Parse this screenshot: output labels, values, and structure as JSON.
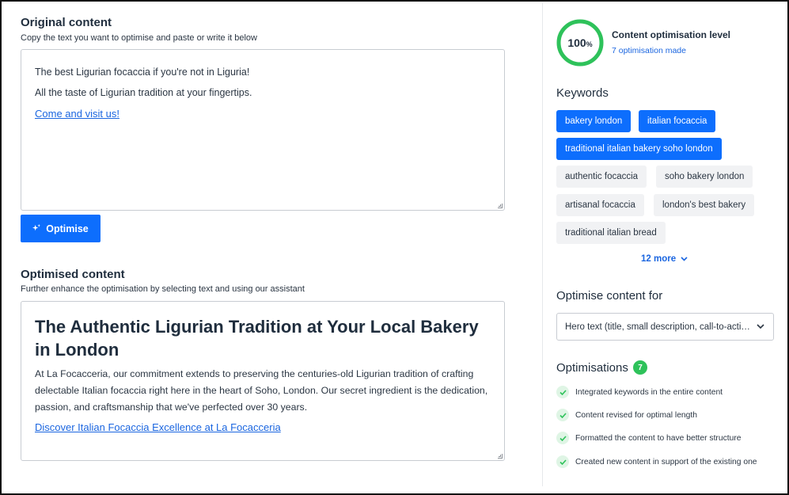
{
  "original": {
    "title": "Original content",
    "subtitle": "Copy the text you want to optimise and paste or write it below",
    "line1": "The best Ligurian focaccia if you're not in Liguria!",
    "line2": "All the taste of Ligurian tradition at your fingertips.",
    "link": "Come and visit us!",
    "optimise_button": "Optimise"
  },
  "optimised": {
    "title": "Optimised content",
    "subtitle": "Further enhance the optimisation by selecting text and using our assistant",
    "heading_line1": "The Authentic Ligurian Tradition at Your Local Bakery",
    "heading_line2": "in London",
    "para_line1": "At La Focacceria, our commitment extends to preserving the centuries-old Ligurian tradition of crafting",
    "para_line2": "delectable Italian focaccia right here in the heart of Soho, London. Our secret ingredient is the dedication,",
    "para_line3": "passion, and craftsmanship that we've perfected over 30 years.",
    "link": "Discover Italian Focaccia Excellence at La Focacceria"
  },
  "score": {
    "value": "100",
    "unit": "%",
    "percent": 100,
    "label": "Content optimisation level",
    "made": "7 optimisation made",
    "color": "#2ec25a"
  },
  "keywords": {
    "title": "Keywords",
    "chips": [
      {
        "label": "bakery london",
        "selected": true
      },
      {
        "label": "italian focaccia",
        "selected": true
      },
      {
        "label": "traditional italian bakery soho london",
        "selected": true
      },
      {
        "label": "authentic focaccia",
        "selected": false
      },
      {
        "label": "soho bakery london",
        "selected": false
      },
      {
        "label": "artisanal focaccia",
        "selected": false
      },
      {
        "label": "london's best bakery",
        "selected": false
      },
      {
        "label": "traditional italian bread",
        "selected": false
      }
    ],
    "more": "12 more"
  },
  "optimise_for": {
    "title": "Optimise content for",
    "selected": "Hero text (title, small description, call-to-action)"
  },
  "optimisations": {
    "title": "Optimisations",
    "count": "7",
    "items": [
      "Integrated keywords in the entire content",
      "Content revised for optimal length",
      "Formatted the content to have better structure",
      "Created new content in support of the existing one"
    ]
  },
  "colors": {
    "accent": "#0d6efd",
    "success": "#2ec25a",
    "link": "#1b66e0"
  }
}
